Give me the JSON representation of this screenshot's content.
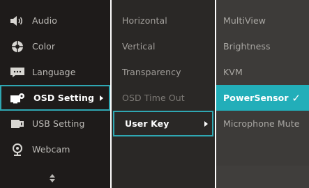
{
  "main_menu": {
    "items": [
      {
        "label": "Audio",
        "icon": "speaker-icon"
      },
      {
        "label": "Color",
        "icon": "color-wheel-icon"
      },
      {
        "label": "Language",
        "icon": "speech-bubble-icon"
      },
      {
        "label": "OSD Setting",
        "icon": "monitor-gear-icon",
        "selected": true
      },
      {
        "label": "USB Setting",
        "icon": "usb-icon"
      },
      {
        "label": "Webcam",
        "icon": "webcam-icon"
      }
    ],
    "scroll_indicator": "up-down-arrows-icon"
  },
  "sub_menu": {
    "items": [
      {
        "label": "Horizontal"
      },
      {
        "label": "Vertical"
      },
      {
        "label": "Transparency"
      },
      {
        "label": "OSD Time Out"
      },
      {
        "label": "User Key",
        "selected": true
      }
    ]
  },
  "options": {
    "items": [
      {
        "label": "MultiView"
      },
      {
        "label": "Brightness"
      },
      {
        "label": "KVM"
      },
      {
        "label": "PowerSensor",
        "highlighted": true,
        "checked": true
      },
      {
        "label": "Microphone Mute"
      }
    ],
    "check_mark": "✓"
  },
  "colors": {
    "accent": "#2fa7b2",
    "highlight": "#22aeb9",
    "panel_main": "#1e1b1a",
    "panel_sub": "#2a2826",
    "panel_opt": "#3d3b39"
  }
}
